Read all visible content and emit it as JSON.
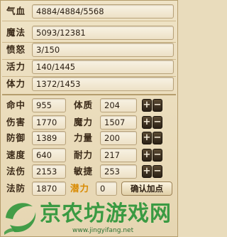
{
  "resources": [
    {
      "label": "气血",
      "value": "4884/4884/5568"
    },
    {
      "label": "魔法",
      "value": "5093/12381"
    },
    {
      "label": "愤怒",
      "value": "3/150"
    },
    {
      "label": "活力",
      "value": "140/1445"
    },
    {
      "label": "体力",
      "value": "1372/1453"
    }
  ],
  "combat": [
    {
      "label": "命中",
      "value": "955"
    },
    {
      "label": "伤害",
      "value": "1770"
    },
    {
      "label": "防御",
      "value": "1389"
    },
    {
      "label": "速度",
      "value": "640"
    },
    {
      "label": "法伤",
      "value": "2153"
    },
    {
      "label": "法防",
      "value": "1870"
    }
  ],
  "attributes": [
    {
      "label": "体质",
      "value": "204"
    },
    {
      "label": "魔力",
      "value": "1507"
    },
    {
      "label": "力量",
      "value": "200"
    },
    {
      "label": "耐力",
      "value": "217"
    },
    {
      "label": "敏捷",
      "value": "253"
    }
  ],
  "potential": {
    "label": "潜力",
    "value": "0"
  },
  "stepper": {
    "plus": "+",
    "minus": "−"
  },
  "confirm_label": "确认加点",
  "watermark": {
    "title": "京农坊游戏网",
    "url": "www.jingyifang.net"
  },
  "colors": {
    "potential_label": "#d98a00",
    "watermark": "#3a9a42"
  }
}
